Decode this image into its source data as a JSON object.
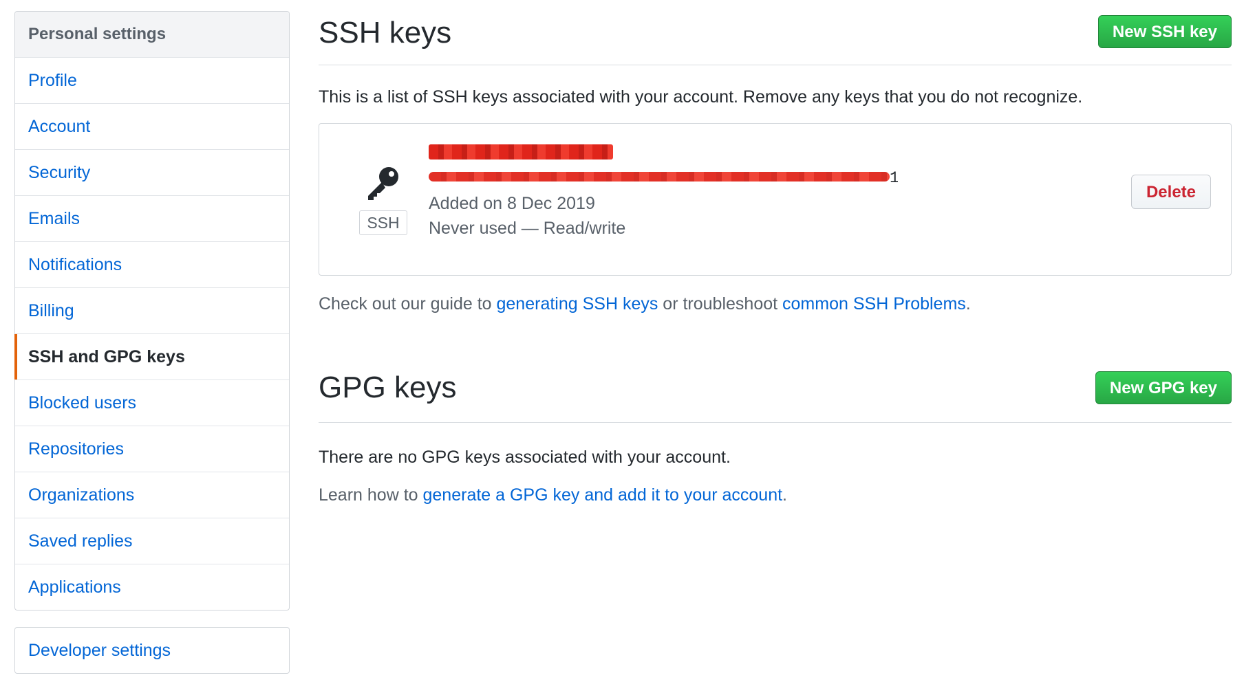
{
  "sidebar": {
    "heading": "Personal settings",
    "items": [
      {
        "label": "Profile"
      },
      {
        "label": "Account"
      },
      {
        "label": "Security"
      },
      {
        "label": "Emails"
      },
      {
        "label": "Notifications"
      },
      {
        "label": "Billing"
      },
      {
        "label": "SSH and GPG keys",
        "selected": true
      },
      {
        "label": "Blocked users"
      },
      {
        "label": "Repositories"
      },
      {
        "label": "Organizations"
      },
      {
        "label": "Saved replies"
      },
      {
        "label": "Applications"
      }
    ],
    "developer_settings": "Developer settings"
  },
  "ssh": {
    "title": "SSH keys",
    "new_button": "New SSH key",
    "description": "This is a list of SSH keys associated with your account. Remove any keys that you do not recognize.",
    "key": {
      "type_label": "SSH",
      "fingerprint_tail": "1",
      "added": "Added on 8 Dec 2019",
      "usage": "Never used — Read/write",
      "delete_label": "Delete"
    },
    "guide_prefix": "Check out our guide to ",
    "guide_link1": "generating SSH keys",
    "guide_mid": " or troubleshoot ",
    "guide_link2": "common SSH Problems",
    "guide_suffix": "."
  },
  "gpg": {
    "title": "GPG keys",
    "new_button": "New GPG key",
    "empty_text": "There are no GPG keys associated with your account.",
    "learn_prefix": "Learn how to ",
    "learn_link": "generate a GPG key and add it to your account",
    "learn_suffix": "."
  },
  "colors": {
    "link": "#0366d6",
    "primary_green": "#28a745",
    "danger_red": "#cb2431",
    "selected_accent": "#e36209",
    "redaction": "#e0251b"
  }
}
